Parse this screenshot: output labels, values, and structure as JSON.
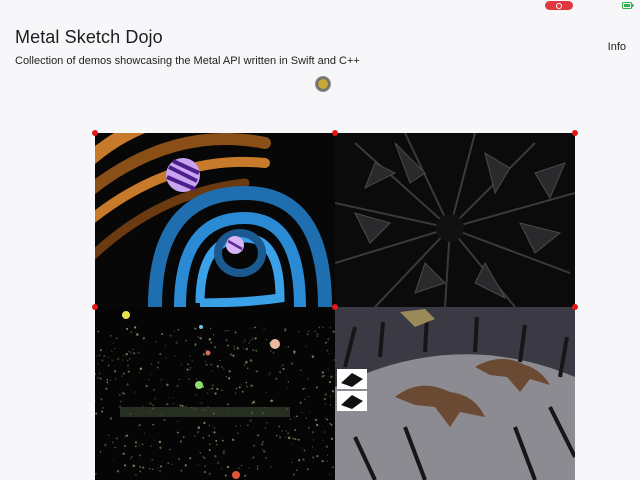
{
  "header": {
    "title": "Metal Sketch Dojo",
    "subtitle": "Collection of demos showcasing the Metal API written in Swift and C++",
    "info_label": "Info"
  },
  "status_bar": {
    "record_indicator": "screen-recording-icon",
    "battery_indicator": "battery-charging-icon"
  },
  "tiles": [
    {
      "name": "tile-1",
      "icon": "tunnel-rings-demo"
    },
    {
      "name": "tile-2",
      "icon": "shard-burst-demo"
    },
    {
      "name": "tile-3",
      "icon": "particle-field-demo"
    },
    {
      "name": "tile-4",
      "icon": "dinosaur-scene-demo"
    }
  ],
  "colors": {
    "background": "#f7f7f9",
    "corner_marker": "#e0181b",
    "handle": "#c9a638",
    "record": "#e0383f"
  }
}
